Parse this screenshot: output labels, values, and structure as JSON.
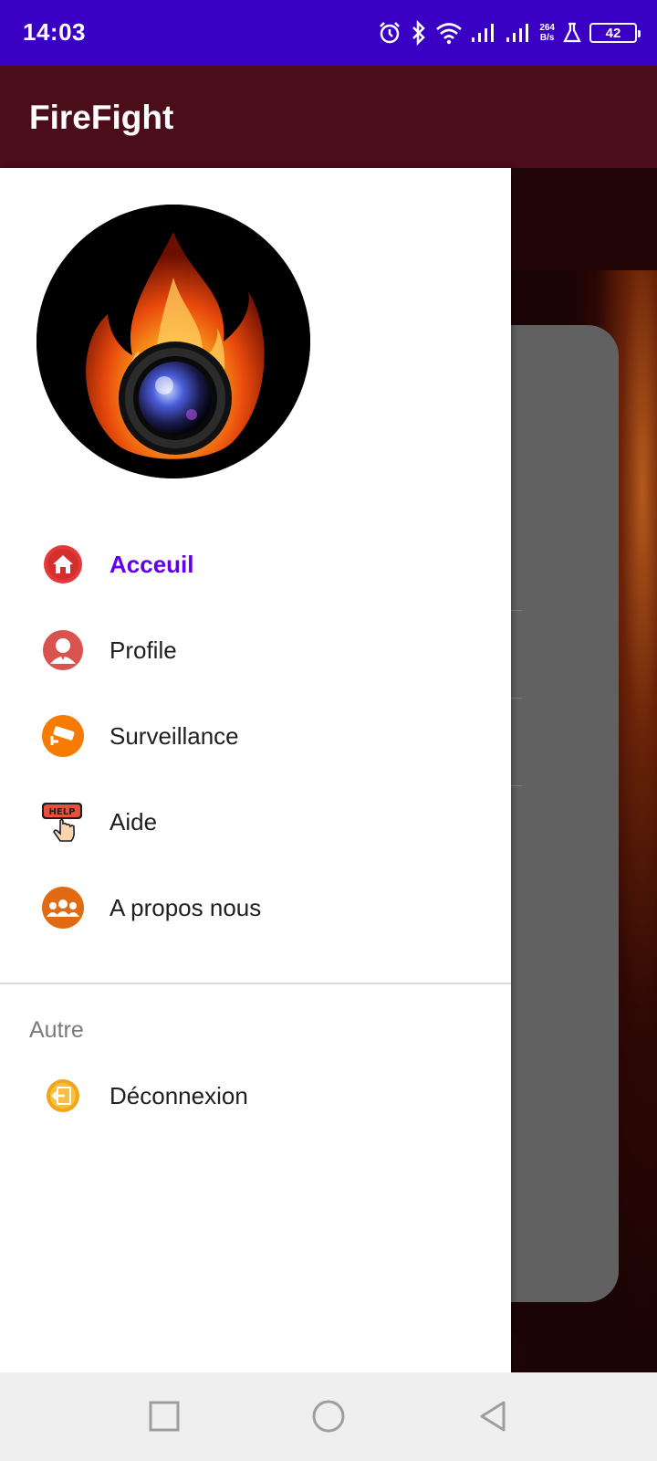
{
  "status_bar": {
    "time": "14:03",
    "net_speed_value": "264",
    "net_speed_unit": "B/s",
    "battery": "42",
    "icons": [
      "alarm-icon",
      "bluetooth-icon",
      "wifi-icon",
      "signal-icon",
      "signal-icon",
      "flask-icon",
      "battery-icon"
    ]
  },
  "app_bar": {
    "title": "FireFight"
  },
  "drawer": {
    "logo": "fire-camera-logo",
    "items": [
      {
        "label": "Acceuil",
        "icon": "home-icon",
        "active": true
      },
      {
        "label": "Profile",
        "icon": "profile-icon",
        "active": false
      },
      {
        "label": "Surveillance",
        "icon": "cctv-camera-icon",
        "active": false
      },
      {
        "label": "Aide",
        "icon": "help-icon",
        "active": false
      },
      {
        "label": "A propos nous",
        "icon": "group-icon",
        "active": false
      }
    ],
    "section_header": "Autre",
    "other_items": [
      {
        "label": "Déconnexion",
        "icon": "logout-icon"
      }
    ]
  },
  "nav_bar": {
    "buttons": [
      "recents-button",
      "home-button",
      "back-button"
    ]
  },
  "colors": {
    "status_bar": "#3a00c4",
    "app_bar": "#4b0d1a",
    "active_item": "#6200ee"
  }
}
